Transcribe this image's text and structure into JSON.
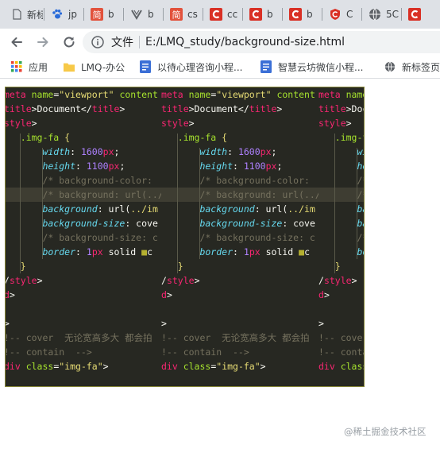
{
  "tabs": [
    {
      "label": "新标签",
      "icon": "document-icon",
      "color": "#5f6368"
    },
    {
      "label": "jp",
      "icon": "paw-icon",
      "color": "#2a6cd9"
    },
    {
      "label": "b",
      "icon": "jian-icon",
      "color": "#e2523c"
    },
    {
      "label": "b",
      "icon": "v-logo-icon",
      "color": "#5f6368"
    },
    {
      "label": "cs",
      "icon": "jian-icon",
      "color": "#e2523c"
    },
    {
      "label": "cc",
      "icon": "c-logo-icon",
      "color": "#d93025"
    },
    {
      "label": "b",
      "icon": "c-logo-icon",
      "color": "#d93025"
    },
    {
      "label": "b",
      "icon": "c-logo-icon",
      "color": "#d93025"
    },
    {
      "label": "C",
      "icon": "shield-icon",
      "color": "#d93025"
    },
    {
      "label": "5C",
      "icon": "globe-icon",
      "color": "#5f6368"
    },
    {
      "label": "",
      "icon": "c-logo-icon",
      "color": "#d93025"
    }
  ],
  "address": {
    "scheme_label": "文件",
    "url": "E:/LMQ_study/background-size.html"
  },
  "bookmarks": [
    {
      "label": "应用",
      "icon": "apps-grid-icon"
    },
    {
      "label": "LMQ-办公",
      "icon": "folder-icon"
    },
    {
      "label": "以待心理咨询小程...",
      "icon": "bookmark-page-icon"
    },
    {
      "label": "智慧云坊微信小程...",
      "icon": "bookmark-page-icon"
    },
    {
      "label": "新标签页",
      "icon": "globe-icon"
    }
  ],
  "code_lines": [
    [
      {
        "t": "meta ",
        "c": "#f92672"
      },
      {
        "t": "name",
        "c": "#a6e22e"
      },
      {
        "t": "=",
        "c": "#f8f8f2"
      },
      {
        "t": "\"viewport\"",
        "c": "#e6db74"
      },
      {
        "t": " content",
        "c": "#a6e22e"
      }
    ],
    [
      {
        "t": "title",
        "c": "#f92672"
      },
      {
        "t": ">Document</",
        "c": "#f8f8f2"
      },
      {
        "t": "title",
        "c": "#f92672"
      },
      {
        "t": ">",
        "c": "#f8f8f2"
      }
    ],
    [
      {
        "t": "style",
        "c": "#f92672"
      },
      {
        "t": ">",
        "c": "#f8f8f2"
      }
    ],
    [
      {
        "t": "   .img-fa ",
        "c": "#a6e22e"
      },
      {
        "t": "{",
        "c": "#e6db74"
      }
    ],
    [
      {
        "t": "       width",
        "c": "#66d9ef"
      },
      {
        "t": ": ",
        "c": "#f8f8f2"
      },
      {
        "t": "1600",
        "c": "#ae81ff"
      },
      {
        "t": "px",
        "c": "#f92672"
      },
      {
        "t": ";",
        "c": "#f8f8f2"
      }
    ],
    [
      {
        "t": "       height",
        "c": "#66d9ef"
      },
      {
        "t": ": ",
        "c": "#f8f8f2"
      },
      {
        "t": "1100",
        "c": "#ae81ff"
      },
      {
        "t": "px",
        "c": "#f92672"
      },
      {
        "t": ";",
        "c": "#f8f8f2"
      }
    ],
    [
      {
        "t": "       /* background-color:",
        "c": "#75715e"
      }
    ],
    [
      {
        "t": "       /* background: url(../",
        "c": "#75715e"
      }
    ],
    [
      {
        "t": "       background",
        "c": "#66d9ef"
      },
      {
        "t": ": url(",
        "c": "#f8f8f2"
      },
      {
        "t": "../im",
        "c": "#e6db74"
      }
    ],
    [
      {
        "t": "       background-size",
        "c": "#66d9ef"
      },
      {
        "t": ": cove",
        "c": "#f8f8f2"
      }
    ],
    [
      {
        "t": "       /* background-size: c",
        "c": "#75715e"
      }
    ],
    [
      {
        "t": "       border",
        "c": "#66d9ef"
      },
      {
        "t": ": ",
        "c": "#f8f8f2"
      },
      {
        "t": "1",
        "c": "#ae81ff"
      },
      {
        "t": "px",
        "c": "#f92672"
      },
      {
        "t": " solid ",
        "c": "#f8f8f2"
      },
      {
        "t": "■",
        "c": "#b5b030"
      },
      {
        "t": "c",
        "c": "#f8f8f2"
      }
    ],
    [
      {
        "t": "   }",
        "c": "#e6db74"
      }
    ],
    [
      {
        "t": "/",
        "c": "#f8f8f2"
      },
      {
        "t": "style",
        "c": "#f92672"
      },
      {
        "t": ">",
        "c": "#f8f8f2"
      }
    ],
    [
      {
        "t": "d",
        "c": "#f92672"
      },
      {
        "t": ">",
        "c": "#f8f8f2"
      }
    ],
    [
      {
        "t": "",
        "c": "#f8f8f2"
      }
    ],
    [
      {
        "t": ">",
        "c": "#f8f8f2"
      }
    ],
    [
      {
        "t": "!-- cover  无论宽高多大 都会拍",
        "c": "#75715e"
      }
    ],
    [
      {
        "t": "!-- contain  -->",
        "c": "#75715e"
      }
    ],
    [
      {
        "t": "div ",
        "c": "#f92672"
      },
      {
        "t": "class",
        "c": "#a6e22e"
      },
      {
        "t": "=",
        "c": "#f8f8f2"
      },
      {
        "t": "\"img-fa\"",
        "c": "#e6db74"
      },
      {
        "t": ">",
        "c": "#f8f8f2"
      }
    ]
  ],
  "watermark": "@稀土掘金技术社区"
}
